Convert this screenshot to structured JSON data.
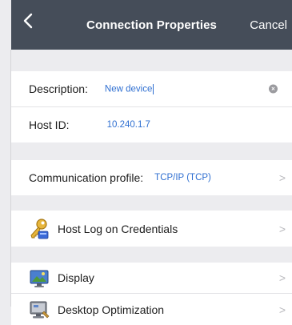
{
  "navbar": {
    "back_icon": "chevron-left-icon",
    "title": "Connection Properties",
    "cancel_label": "Cancel"
  },
  "connection": {
    "description_label": "Description:",
    "description_value": "New device",
    "host_id_label": "Host ID:",
    "host_id_value": "10.240.1.7"
  },
  "communication": {
    "label": "Communication profile:",
    "value": "TCP/IP (TCP)"
  },
  "menu": {
    "credentials_label": "Host Log on Credentials",
    "display_label": "Display",
    "desktop_label": "Desktop Optimization"
  },
  "colors": {
    "navbar_bg": "#454d59",
    "accent_blue": "#2f6fd1",
    "background": "#ececef"
  }
}
